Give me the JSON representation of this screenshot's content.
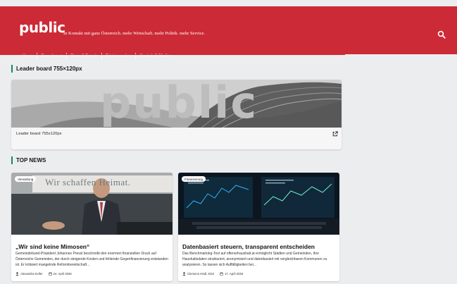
{
  "header": {
    "logo": "public",
    "tagline": "In Kontakt mit ganz Österreich. mehr Wirtschaft. mehr Politik. mehr Service.",
    "search_icon": "search-icon",
    "brand_color": "#cc2a36"
  },
  "nav": {
    "items": [
      {
        "label": "Home"
      },
      {
        "label": "Branchen",
        "icon": "chevron-down-icon"
      },
      {
        "label": "Tipps & Events"
      },
      {
        "label": "Printausgaben"
      },
      {
        "label": "Kontakt & Media"
      }
    ]
  },
  "leaderboard": {
    "heading": "Leader board 755×120px",
    "image_word": "public",
    "caption": "Leader board 755x120px",
    "link_icon": "external-link-icon"
  },
  "top_news": {
    "heading": "TOP NEWS",
    "accent_color": "#0f8a5a",
    "cards": [
      {
        "badge": "Verwaltung",
        "image_text": "Wir schaffen Heimat.",
        "title": "„Wir sind keine Mimosen“",
        "text": "Gemeindebund-Präsident Johannes Pressl beschreibt den enormen finanziellen Druck auf Österreichs Gemeinden, der durch steigende Kosten und fehlende Gegenfinanzierung entstanden ist. Er kritisiert mangelnde Reformbereitschaft...",
        "author": "Alexandra Keller",
        "date": "24. April 2026"
      },
      {
        "badge": "Finanzierung",
        "title": "Datenbasiert steuern, transparent entscheiden",
        "text": "Das Benchmarking-Tool auf offenerhaushalt.at ermöglicht Städten und Gemeinden, ihre Haushaltsdaten strukturiert, anonymisiert und datenbasiert mit vergleichbaren Kommunen zu analysieren. So lassen sich Auffälligkeiten bei...",
        "author": "Clemens Hödl, KDZ",
        "date": "17. April 2026"
      }
    ]
  }
}
